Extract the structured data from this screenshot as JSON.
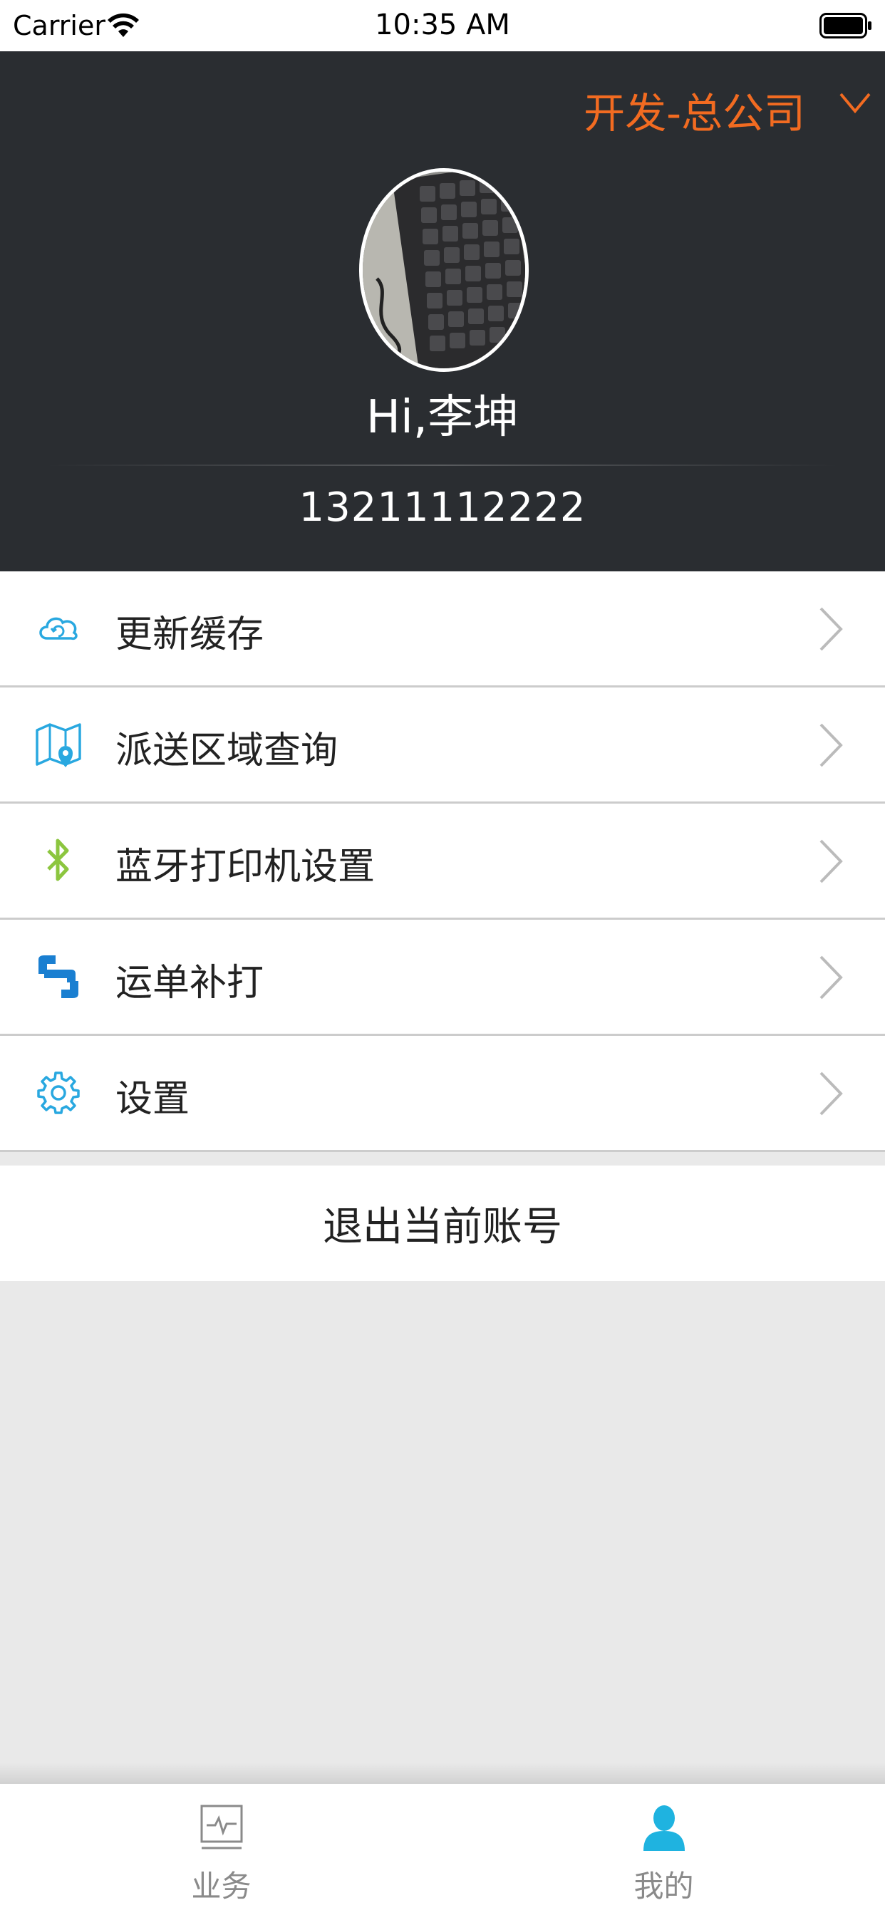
{
  "status_bar": {
    "carrier": "Carrier",
    "time": "10:35 AM"
  },
  "header": {
    "company": "开发-总公司",
    "greeting": "Hi,李坤",
    "phone": "13211112222"
  },
  "menu": {
    "items": [
      {
        "label": "更新缓存",
        "icon": "cloud-refresh-icon"
      },
      {
        "label": "派送区域查询",
        "icon": "map-pin-icon"
      },
      {
        "label": "蓝牙打印机设置",
        "icon": "bluetooth-icon"
      },
      {
        "label": "运单补打",
        "icon": "reprint-icon"
      },
      {
        "label": "设置",
        "icon": "gear-icon"
      }
    ]
  },
  "logout_label": "退出当前账号",
  "tab_bar": {
    "tabs": [
      {
        "label": "业务",
        "icon": "activity-icon",
        "active": false
      },
      {
        "label": "我的",
        "icon": "user-icon",
        "active": true
      }
    ]
  },
  "colors": {
    "header_bg": "#2a2d31",
    "accent_orange": "#f26b21",
    "accent_blue": "#29a8e0",
    "bluetooth_green": "#8cc63f",
    "inactive_gray": "#8a8a8a"
  }
}
